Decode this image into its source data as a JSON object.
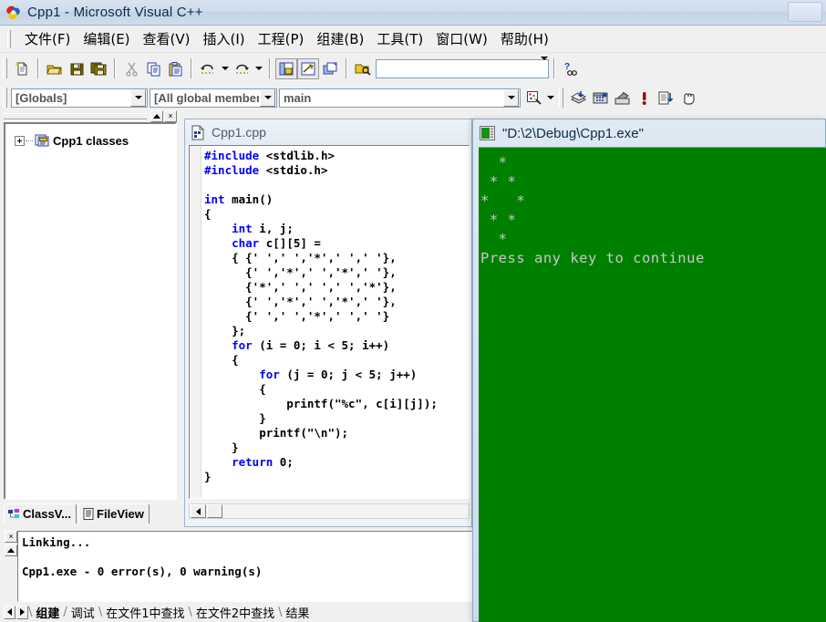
{
  "window": {
    "title": "Cpp1 - Microsoft Visual C++",
    "app_icon": "visual-cpp-icon"
  },
  "menubar": {
    "items": [
      {
        "label": "文件(F)",
        "mnemonic": "F"
      },
      {
        "label": "编辑(E)",
        "mnemonic": "E"
      },
      {
        "label": "查看(V)",
        "mnemonic": "V"
      },
      {
        "label": "插入(I)",
        "mnemonic": "I"
      },
      {
        "label": "工程(P)",
        "mnemonic": "P"
      },
      {
        "label": "组建(B)",
        "mnemonic": "B"
      },
      {
        "label": "工具(T)",
        "mnemonic": "T"
      },
      {
        "label": "窗口(W)",
        "mnemonic": "W"
      },
      {
        "label": "帮助(H)",
        "mnemonic": "H"
      }
    ]
  },
  "toolbar_standard": {
    "buttons": [
      "new-document-icon",
      "open-folder-icon",
      "save-icon",
      "save-all-icon",
      "cut-scissors-icon",
      "copy-icon",
      "paste-icon",
      "undo-icon",
      "undo-dropdown-icon",
      "redo-icon",
      "redo-dropdown-icon",
      "workspace-window-icon",
      "output-window-icon",
      "toggle-windows-icon",
      "find-in-files-icon"
    ],
    "find_box_value": "",
    "find_box_placeholder": "",
    "help_button": "find-help-icon"
  },
  "toolbar_wizardbar": {
    "class_combo": {
      "value": "[Globals]",
      "options": [
        "[Globals]"
      ]
    },
    "filter_combo": {
      "value": "[All global member",
      "options": [
        "[All global member"
      ]
    },
    "member_combo": {
      "value": "main",
      "options": [
        "main"
      ]
    },
    "action_button": "wizardbar-action-icon",
    "buttons": [
      "compile-icon",
      "build-icon",
      "stop-build-icon",
      "execute-icon",
      "go-icon",
      "insert-breakpoint-icon"
    ]
  },
  "workspace": {
    "tree": [
      {
        "label": "Cpp1 classes",
        "icon": "class-folder-icon",
        "expanded": false
      }
    ],
    "tabs": [
      {
        "label": "ClassV...",
        "icon": "classview-icon",
        "active": true
      },
      {
        "label": "FileView",
        "icon": "fileview-icon",
        "active": false
      }
    ],
    "caption_buttons": [
      "restore-button",
      "close-button"
    ]
  },
  "editor": {
    "title": "Cpp1.cpp",
    "icon": "source-file-icon",
    "lines": [
      [
        {
          "t": "#include",
          "k": true
        },
        {
          "t": " <stdlib.h>",
          "k": false
        }
      ],
      [
        {
          "t": "#include",
          "k": true
        },
        {
          "t": " <stdio.h>",
          "k": false
        }
      ],
      [
        {
          "t": "",
          "k": false
        }
      ],
      [
        {
          "t": "int",
          "k": true
        },
        {
          "t": " main()",
          "k": false
        }
      ],
      [
        {
          "t": "{",
          "k": false
        }
      ],
      [
        {
          "t": "    ",
          "k": false
        },
        {
          "t": "int",
          "k": true
        },
        {
          "t": " i, j;",
          "k": false
        }
      ],
      [
        {
          "t": "    ",
          "k": false
        },
        {
          "t": "char",
          "k": true
        },
        {
          "t": " c[][5] =",
          "k": false
        }
      ],
      [
        {
          "t": "    { {' ',' ','*',' ',' '},",
          "k": false
        }
      ],
      [
        {
          "t": "      {' ','*',' ','*',' '},",
          "k": false
        }
      ],
      [
        {
          "t": "      {'*',' ',' ',' ','*'},",
          "k": false
        }
      ],
      [
        {
          "t": "      {' ','*',' ','*',' '},",
          "k": false
        }
      ],
      [
        {
          "t": "      {' ',' ','*',' ',' '}",
          "k": false
        }
      ],
      [
        {
          "t": "    };",
          "k": false
        }
      ],
      [
        {
          "t": "    ",
          "k": false
        },
        {
          "t": "for",
          "k": true
        },
        {
          "t": " (i = 0; i < 5; i++)",
          "k": false
        }
      ],
      [
        {
          "t": "    {",
          "k": false
        }
      ],
      [
        {
          "t": "        ",
          "k": false
        },
        {
          "t": "for",
          "k": true
        },
        {
          "t": " (j = 0; j < 5; j++)",
          "k": false
        }
      ],
      [
        {
          "t": "        {",
          "k": false
        }
      ],
      [
        {
          "t": "            printf(\"%c\", c[i][j]);",
          "k": false
        }
      ],
      [
        {
          "t": "        }",
          "k": false
        }
      ],
      [
        {
          "t": "        printf(\"\\n\");",
          "k": false
        }
      ],
      [
        {
          "t": "    }",
          "k": false
        }
      ],
      [
        {
          "t": "    ",
          "k": false
        },
        {
          "t": "return",
          "k": true
        },
        {
          "t": " 0;",
          "k": false
        }
      ],
      [
        {
          "t": "}",
          "k": false
        }
      ]
    ]
  },
  "output": {
    "text": "Linking...\n\nCpp1.exe - 0 error(s), 0 warning(s)",
    "close_button": "close-output-icon",
    "scroll_up_button": "scroll-up-icon",
    "tabs": [
      {
        "label": "组建",
        "active": true
      },
      {
        "label": "调试",
        "active": false
      },
      {
        "label": "在文件1中查找",
        "active": false
      },
      {
        "label": "在文件2中查找",
        "active": false
      },
      {
        "label": "结果",
        "active": false
      }
    ]
  },
  "console": {
    "title": "\"D:\\2\\Debug\\Cpp1.exe\"",
    "icon": "console-window-icon",
    "background_color": "#008000",
    "text_color": "#c8c8c8",
    "lines": [
      "  *  ",
      " * * ",
      "*   *",
      " * * ",
      "  *  ",
      "Press any key to continue"
    ]
  }
}
